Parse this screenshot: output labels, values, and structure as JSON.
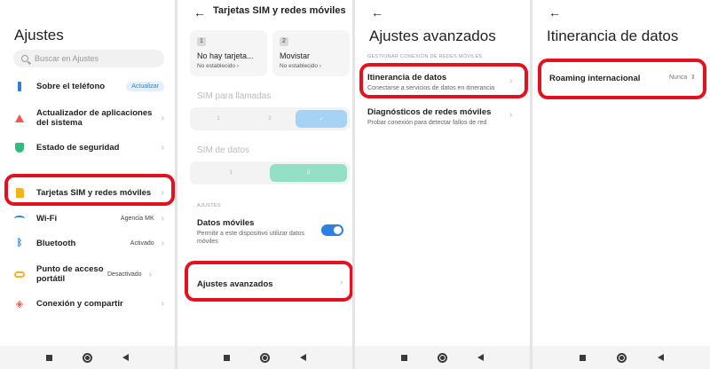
{
  "panel1": {
    "title": "Ajustes",
    "search_placeholder": "Buscar en Ajustes",
    "items": [
      {
        "label": "Sobre el teléfono",
        "badge": "Actualizar"
      },
      {
        "label": "Actualizador de aplicaciones del sistema"
      },
      {
        "label": "Estado de seguridad"
      },
      {
        "label": "Tarjetas SIM y redes móviles"
      },
      {
        "label": "Wi-Fi",
        "value": "Agencia MK"
      },
      {
        "label": "Bluetooth",
        "value": "Activado"
      },
      {
        "label": "Punto de acceso portátil",
        "value": "Desactivado"
      },
      {
        "label": "Conexión y compartir"
      }
    ]
  },
  "panel2": {
    "title": "Tarjetas SIM y redes móviles",
    "sim1": {
      "num": "1",
      "name": "No hay tarjeta...",
      "status": "No establecido ›"
    },
    "sim2": {
      "num": "2",
      "name": "Movistar",
      "status": "No establecido ›"
    },
    "calls_label": "SIM para llamadas",
    "calls_options": [
      "1",
      "2",
      "✓"
    ],
    "data_label": "SIM de datos",
    "data_options": [
      "1",
      "2"
    ],
    "section": "AJUSTES",
    "mobile_data_title": "Datos móviles",
    "mobile_data_desc": "Permitir a este dispositivo utilizar datos móviles",
    "advanced": "Ajustes avanzados"
  },
  "panel3": {
    "title": "Ajustes avanzados",
    "section": "GESTIONAR CONEXIÓN DE REDES MÓVILES",
    "roaming_title": "Itinerancia de datos",
    "roaming_desc": "Conectarse a servicios de datos en itinerancia",
    "diag_title": "Diagnósticos de redes móviles",
    "diag_desc": "Probar conexión para detectar fallos de red"
  },
  "panel4": {
    "title": "Itinerancia de datos",
    "roaming_intl": "Roaming internacional",
    "roaming_value": "Nunca"
  },
  "colors": {
    "highlight": "#e4111e",
    "accent": "#2f80e6"
  }
}
